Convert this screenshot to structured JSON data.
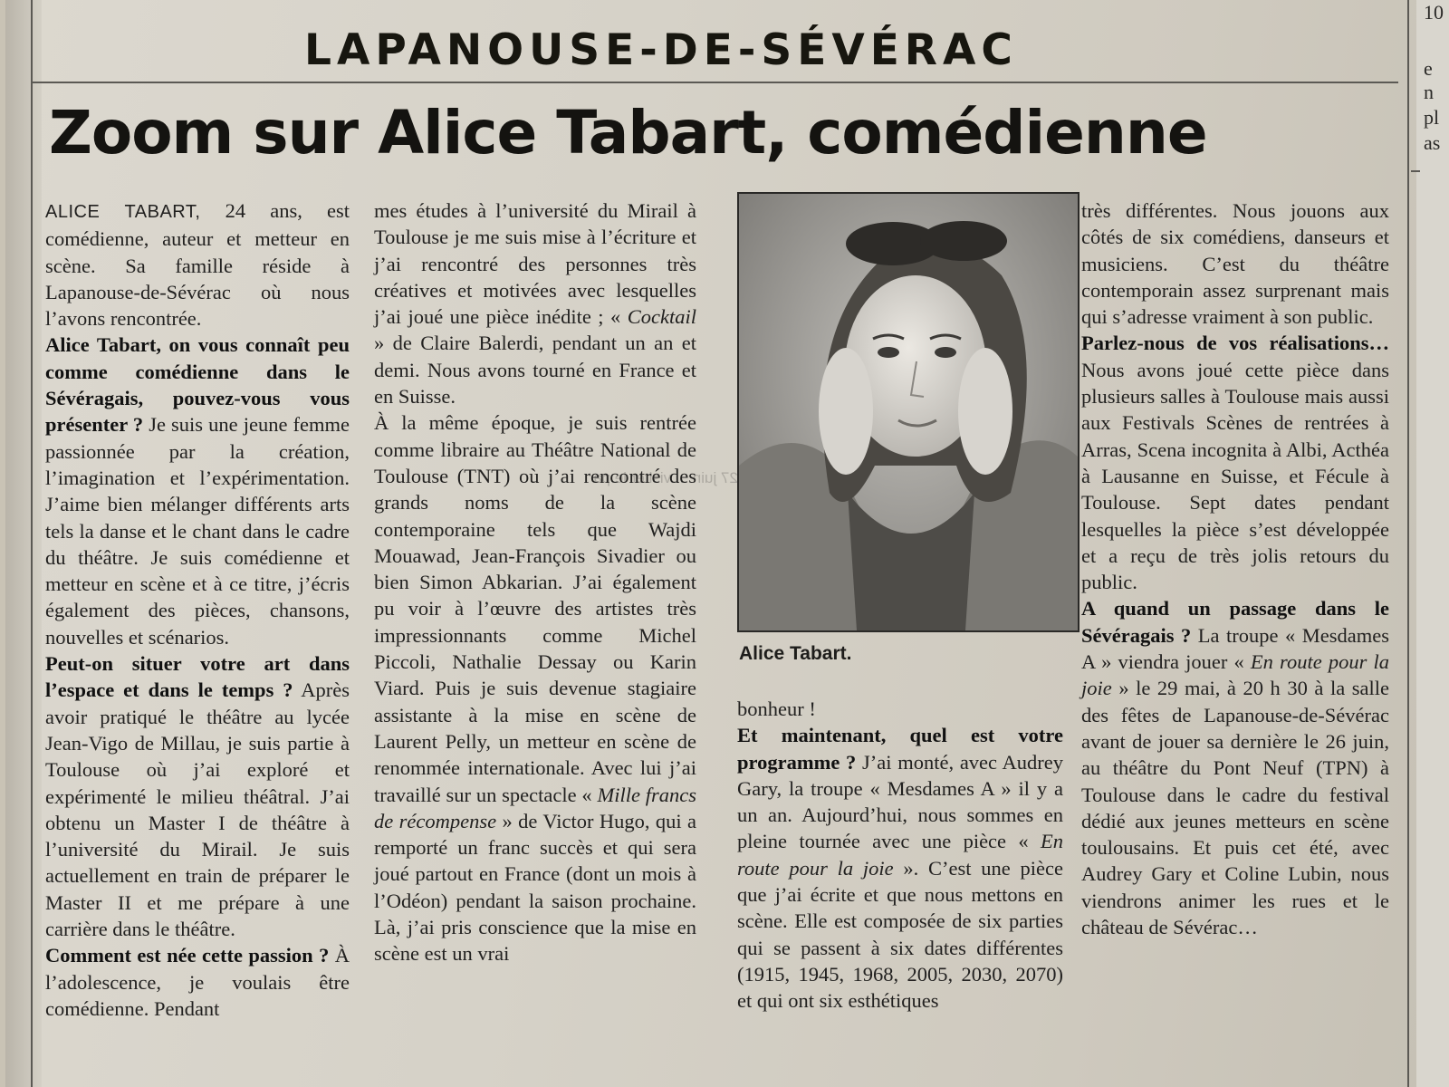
{
  "article": {
    "kicker": "LAPANOUSE-DE-SÉVÉRAC",
    "headline": "Zoom sur Alice Tabart, comédienne",
    "photo_caption": "Alice Tabart.",
    "col1": {
      "p1_lead": "ALICE TABART,",
      "p1_text": " 24 ans, est comédienne, auteur et metteur en scène. Sa famille réside à Lapanouse-de-Sévérac où nous l’avons rencontrée.",
      "q1": "Alice Tabart, on vous connaît peu comme comédienne dans le Sévéragais, pouvez-vous vous présenter ?",
      "a1": " Je suis une jeune femme passionnée par la création, l’imagination et l’expérimentation. J’aime bien mélanger différents arts tels la danse et le chant dans le cadre du théâtre. Je suis comédienne et metteur en scène et à ce titre, j’écris également des pièces, chansons, nouvelles et scénarios.",
      "q2": "Peut-on situer votre art dans l’espace et dans le temps ?",
      "a2": " Après avoir pratiqué le théâtre au lycée Jean-Vigo de Millau, je suis partie à Toulouse où j’ai exploré et expérimenté le milieu théâtral. J’ai obtenu un Master I de théâtre à l’université du Mirail. Je suis actuellement en train de préparer le Master II et me prépare à une carrière dans le théâtre.",
      "q3": "Comment est née cette passion ?",
      "a3": " À l’adolescence, je voulais être comédienne. Pendant"
    },
    "col2": {
      "p1_a": "mes études à l’université du Mirail à Toulouse je me suis mise à l’écriture et j’ai rencontré des personnes très créatives et motivées avec lesquelles j’ai joué une pièce inédite ; « ",
      "p1_title": "Cocktail",
      "p1_b": " » de Claire Balerdi, pendant un an et demi. Nous avons tourné en France et en Suisse.",
      "p2_a": "À la même époque, je suis rentrée comme libraire au Théâtre National de Toulouse (TNT) où j’ai rencontré des grands noms de la scène contemporaine tels que Wajdi Mouawad, Jean-François Sivadier ou bien Simon Abkarian. J’ai également pu voir à l’œuvre des artistes très impressionnants comme Michel Piccoli, Nathalie Dessay ou Karin Viard. Puis je suis devenue stagiaire assistante à la mise en scène de Laurent Pelly, un metteur en scène de renommée internationale. Avec lui j’ai travaillé sur un spectacle « ",
      "p2_title": "Mille francs de récompense",
      "p2_b": " » de Victor Hugo, qui a remporté un franc succès et qui sera joué partout en France (dont un mois à l’Odéon) pendant la saison prochaine. Là, j’ai pris conscience que la mise en scène est un vrai"
    },
    "col3": {
      "p1": "bonheur !",
      "q4": "Et maintenant, quel est votre programme ?",
      "a4_a": " J’ai monté, avec Audrey Gary, la troupe « Mesdames A » il y a un an. Aujourd’hui, nous sommes en pleine tournée avec une pièce « ",
      "a4_title": "En route pour la joie",
      "a4_b": " ». C’est une pièce que j’ai écrite et que nous mettons en scène. Elle est composée de six parties qui se passent à six dates différentes (1915, 1945, 1968, 2005, 2030, 2070) et qui ont six esthétiques"
    },
    "col4": {
      "p1": "très différentes. Nous jouons aux côtés de six comédiens, danseurs et musiciens. C’est du théâtre contemporain assez surprenant mais qui s’adresse vraiment à son public.",
      "q5": "Parlez-nous de vos réalisations…",
      "a5": " Nous avons joué cette pièce dans plusieurs salles à Toulouse mais aussi aux Festivals Scènes de rentrées à Arras, Scena incognita à Albi, Acthéa à Lausanne en Suisse, et Fécule à Toulouse. Sept dates pendant lesquelles la pièce s’est développée et a reçu de très jolis retours du public.",
      "q6": "A quand un passage dans le Sévéragais ?",
      "a6_a": " La troupe « Mesdames A » viendra jouer « ",
      "a6_title": "En route pour la joie",
      "a6_b": " » le 29 mai, à 20 h 30 à la salle des fêtes de Lapanouse-de-Sévérac avant de jouer sa dernière le 26 juin, au théâtre du Pont Neuf (TPN) à Toulouse dans le cadre du festival dédié aux jeunes metteurs en scène toulousains. Et puis cet été, avec Audrey Gary et Coline Lubin, nous viendrons animer les rues et le château de Sévérac…"
    }
  },
  "margin_fragments": [
    "10",
    "e",
    "n",
    "pl",
    "as"
  ],
  "bleed_through": "Treize-Pierre ... vendredi 27 juin ... visiter le pa"
}
